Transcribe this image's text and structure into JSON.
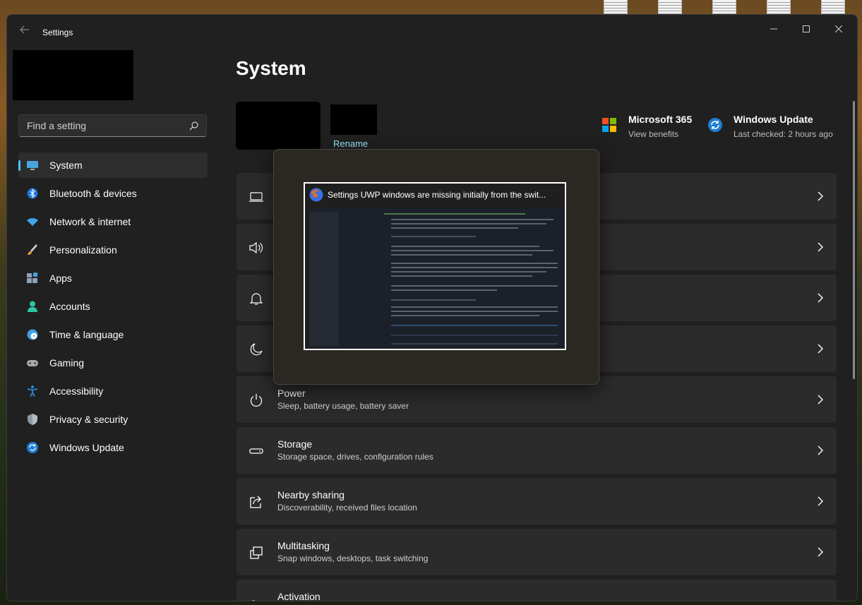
{
  "window": {
    "title": "Settings"
  },
  "search": {
    "placeholder": "Find a setting"
  },
  "sidebar": {
    "items": [
      {
        "label": "System",
        "icon": "monitor-icon",
        "active": true
      },
      {
        "label": "Bluetooth & devices",
        "icon": "bluetooth-icon"
      },
      {
        "label": "Network & internet",
        "icon": "wifi-icon"
      },
      {
        "label": "Personalization",
        "icon": "paintbrush-icon"
      },
      {
        "label": "Apps",
        "icon": "apps-icon"
      },
      {
        "label": "Accounts",
        "icon": "person-icon"
      },
      {
        "label": "Time & language",
        "icon": "globe-clock-icon"
      },
      {
        "label": "Gaming",
        "icon": "gamepad-icon"
      },
      {
        "label": "Accessibility",
        "icon": "accessibility-icon"
      },
      {
        "label": "Privacy & security",
        "icon": "shield-icon"
      },
      {
        "label": "Windows Update",
        "icon": "update-icon"
      }
    ]
  },
  "main": {
    "title": "System",
    "rename": "Rename",
    "promos": [
      {
        "title": "Microsoft 365",
        "subtitle": "View benefits"
      },
      {
        "title": "Windows Update",
        "subtitle": "Last checked: 2 hours ago"
      }
    ],
    "cards": [
      {
        "title": "",
        "subtitle": "",
        "icon": "display-icon"
      },
      {
        "title": "",
        "subtitle": "",
        "icon": "speaker-icon"
      },
      {
        "title": "",
        "subtitle": "",
        "icon": "bell-icon"
      },
      {
        "title": "",
        "subtitle": "",
        "icon": "moon-icon"
      },
      {
        "title": "Power",
        "subtitle": "Sleep, battery usage, battery saver",
        "icon": "power-icon"
      },
      {
        "title": "Storage",
        "subtitle": "Storage space, drives, configuration rules",
        "icon": "storage-icon"
      },
      {
        "title": "Nearby sharing",
        "subtitle": "Discoverability, received files location",
        "icon": "share-icon"
      },
      {
        "title": "Multitasking",
        "subtitle": "Snap windows, desktops, task switching",
        "icon": "multitask-icon"
      },
      {
        "title": "Activation",
        "subtitle": "",
        "icon": "key-icon"
      }
    ]
  },
  "switcher": {
    "window_title": "Settings UWP windows are missing initially from the swit..."
  },
  "colors": {
    "accent": "#4cc2ff",
    "link": "#99ebff",
    "card": "#2b2b2b",
    "window": "#202020"
  }
}
